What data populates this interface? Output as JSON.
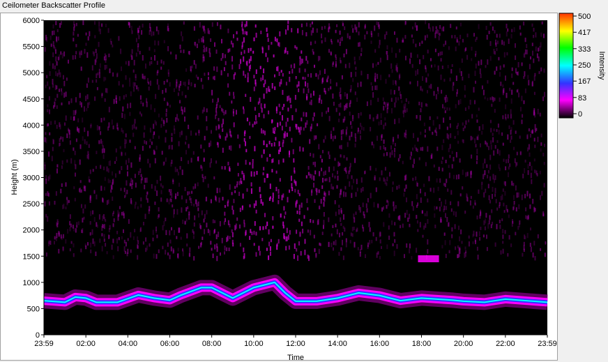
{
  "window": {
    "title": "Ceilometer Backscatter Profile"
  },
  "chart_data": {
    "type": "heatmap",
    "title": "Ceilometer Backscatter Profile",
    "xlabel": "Time",
    "ylabel": "Height (m)",
    "x_ticks": [
      "23:59",
      "02:00",
      "04:00",
      "06:00",
      "08:00",
      "10:00",
      "12:00",
      "14:00",
      "16:00",
      "18:00",
      "20:00",
      "22:00",
      "23:59"
    ],
    "y_ticks": [
      0,
      500,
      1000,
      1500,
      2000,
      2500,
      3000,
      3500,
      4000,
      4500,
      5000,
      5500,
      6000
    ],
    "ylim": [
      0,
      6000
    ],
    "colorbar": {
      "label": "Intensity",
      "ticks": [
        500,
        417,
        333,
        250,
        167,
        83,
        0
      ],
      "range": [
        0,
        500
      ],
      "colors": [
        "#000000",
        "#ff00ff",
        "#3333ff",
        "#00ffff",
        "#00ff00",
        "#ffff00",
        "#ff3300"
      ]
    },
    "layer_height_m": [
      {
        "time": "23:59",
        "height": 650
      },
      {
        "time": "01:00",
        "height": 620
      },
      {
        "time": "01:30",
        "height": 720
      },
      {
        "time": "02:00",
        "height": 700
      },
      {
        "time": "02:30",
        "height": 620
      },
      {
        "time": "03:30",
        "height": 620
      },
      {
        "time": "04:30",
        "height": 760
      },
      {
        "time": "05:15",
        "height": 700
      },
      {
        "time": "06:00",
        "height": 660
      },
      {
        "time": "06:30",
        "height": 750
      },
      {
        "time": "07:30",
        "height": 900
      },
      {
        "time": "08:00",
        "height": 900
      },
      {
        "time": "09:00",
        "height": 700
      },
      {
        "time": "10:00",
        "height": 900
      },
      {
        "time": "11:00",
        "height": 1000
      },
      {
        "time": "11:30",
        "height": 800
      },
      {
        "time": "12:00",
        "height": 640
      },
      {
        "time": "13:00",
        "height": 640
      },
      {
        "time": "14:00",
        "height": 700
      },
      {
        "time": "15:00",
        "height": 800
      },
      {
        "time": "16:00",
        "height": 750
      },
      {
        "time": "17:00",
        "height": 650
      },
      {
        "time": "18:00",
        "height": 700
      },
      {
        "time": "19:30",
        "height": 660
      },
      {
        "time": "20:00",
        "height": 640
      },
      {
        "time": "21:00",
        "height": 620
      },
      {
        "time": "22:00",
        "height": 680
      },
      {
        "time": "23:59",
        "height": 620
      }
    ],
    "elevated_cloud": {
      "time_start": "17:50",
      "time_end": "18:50",
      "height": 1450
    }
  }
}
